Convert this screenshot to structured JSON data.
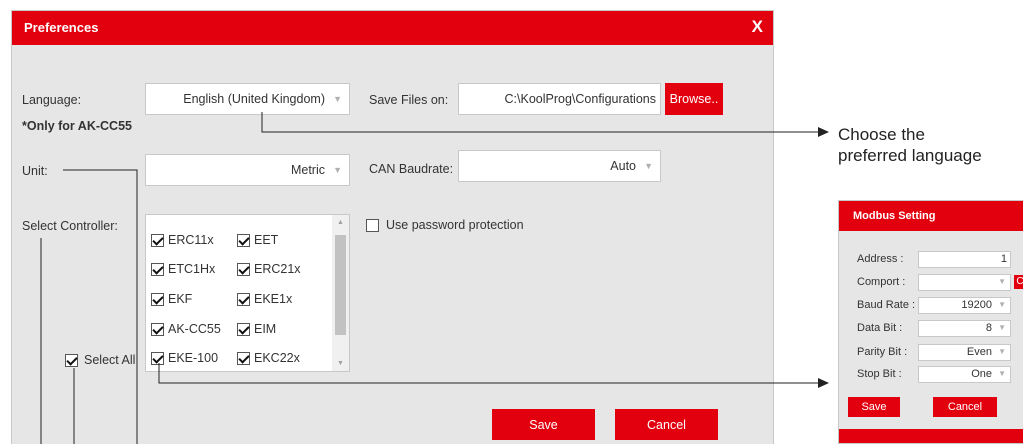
{
  "dialog": {
    "title": "Preferences",
    "close_label": "X",
    "language_label": "Language:",
    "language_value": "English (United Kingdom)",
    "only_note": "*Only for AK-CC55",
    "save_files_label": "Save Files on:",
    "save_path": "C:\\KoolProg\\Configurations",
    "browse_label": "Browse..",
    "unit_label": "Unit:",
    "unit_value": "Metric",
    "can_label": "CAN Baudrate:",
    "can_value": "Auto",
    "select_controller_label": "Select Controller:",
    "password_label": "Use password protection",
    "select_all_label": "Select All",
    "save_label": "Save",
    "cancel_label": "Cancel",
    "controllers": [
      {
        "name": "ERC11x",
        "checked": true
      },
      {
        "name": "EET",
        "checked": true
      },
      {
        "name": "ETC1Hx",
        "checked": true
      },
      {
        "name": "ERC21x",
        "checked": true
      },
      {
        "name": "EKF",
        "checked": true
      },
      {
        "name": "EKE1x",
        "checked": true
      },
      {
        "name": "AK-CC55",
        "checked": true
      },
      {
        "name": "EIM",
        "checked": true
      },
      {
        "name": "EKE-100",
        "checked": true
      },
      {
        "name": "EKC22x",
        "checked": true
      }
    ]
  },
  "annotation": {
    "line1": "Choose the",
    "line2": "preferred language"
  },
  "modbus": {
    "title": "Modbus Setting",
    "address_label": "Address :",
    "address_value": "1",
    "comport_label": "Comport :",
    "comport_value": "",
    "baud_label": "Baud Rate :",
    "baud_value": "19200",
    "databit_label": "Data Bit :",
    "databit_value": "8",
    "parity_label": "Parity Bit :",
    "parity_value": "Even",
    "stopbit_label": "Stop Bit :",
    "stopbit_value": "One",
    "save_label": "Save",
    "cancel_label": "Cancel",
    "badge": "C"
  },
  "colors": {
    "accent": "#e2000f",
    "panel": "#e6e6e6"
  }
}
